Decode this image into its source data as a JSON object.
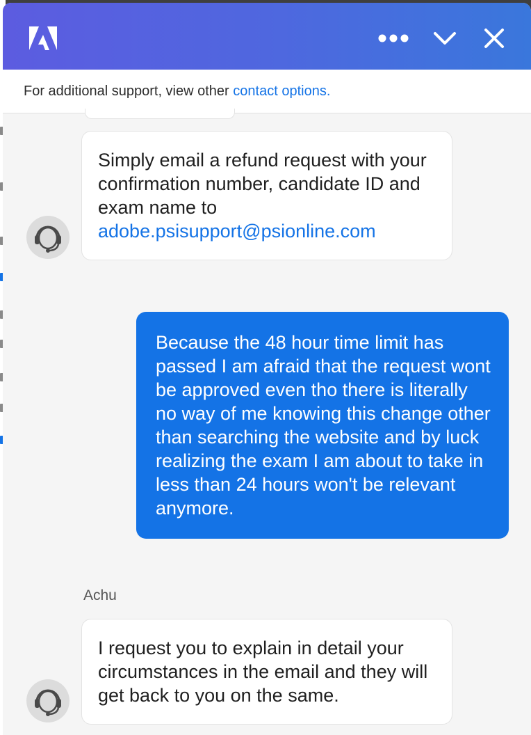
{
  "header": {
    "app": "Adobe",
    "more_label": "More options",
    "minimize_label": "Minimize",
    "close_label": "Close"
  },
  "banner": {
    "text": "For additional support, view other ",
    "link": "contact options."
  },
  "messages": [
    {
      "from": "agent",
      "text": "Simply email a refund request with your confirmation number, candidate ID and exam name to ",
      "link": "adobe.psisupport@psionline.com"
    },
    {
      "from": "user",
      "text": "Because the 48 hour time limit has passed I am afraid that the request wont be approved even tho there is literally no way of me knowing this change other than searching the website and by luck realizing the exam I am about to take in less than 24 hours won't be relevant anymore."
    },
    {
      "from": "agent",
      "name": "Achu",
      "text": "I request you to explain in detail your circumstances in the email and they will get back to you on the same."
    }
  ],
  "colors": {
    "header_start": "#5c5ce0",
    "header_end": "#3a77dc",
    "user_bubble": "#1473e6",
    "link": "#1473e6"
  },
  "icons": [
    "adobe-logo",
    "more-icon",
    "chevron-down-icon",
    "close-icon",
    "headset-icon"
  ]
}
